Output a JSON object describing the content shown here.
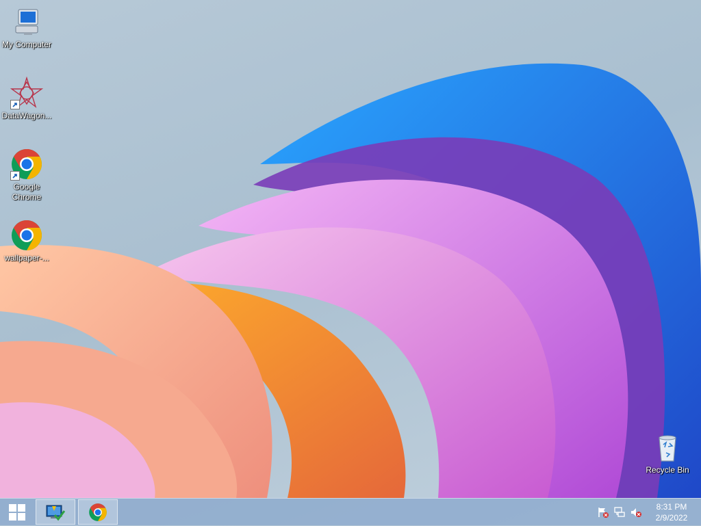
{
  "desktop": {
    "icons": [
      {
        "label": "My Computer",
        "icon": "computer-icon",
        "shortcut": false
      },
      {
        "label": "DataWagon...",
        "icon": "datawagon-icon",
        "shortcut": true
      },
      {
        "label": "Google Chrome",
        "icon": "chrome-icon",
        "shortcut": true
      },
      {
        "label": "wallpaper-...",
        "icon": "chrome-icon",
        "shortcut": false
      },
      {
        "label": "Recycle Bin",
        "icon": "recycle-bin-icon",
        "shortcut": false
      }
    ]
  },
  "taskbar": {
    "start_icon": "windows-logo-icon",
    "pinned": [
      {
        "icon": "action-center-icon"
      },
      {
        "icon": "chrome-icon"
      }
    ],
    "tray": [
      "action-center-flag-icon",
      "network-icon",
      "volume-muted-icon"
    ],
    "clock": {
      "time": "8:31 PM",
      "date": "2/9/2022"
    }
  },
  "colors": {
    "taskbar": "#8caacd",
    "accent_blue": "#1a73e8",
    "chrome_red": "#db4437",
    "chrome_yellow": "#f4b400",
    "chrome_green": "#0f9d58"
  }
}
